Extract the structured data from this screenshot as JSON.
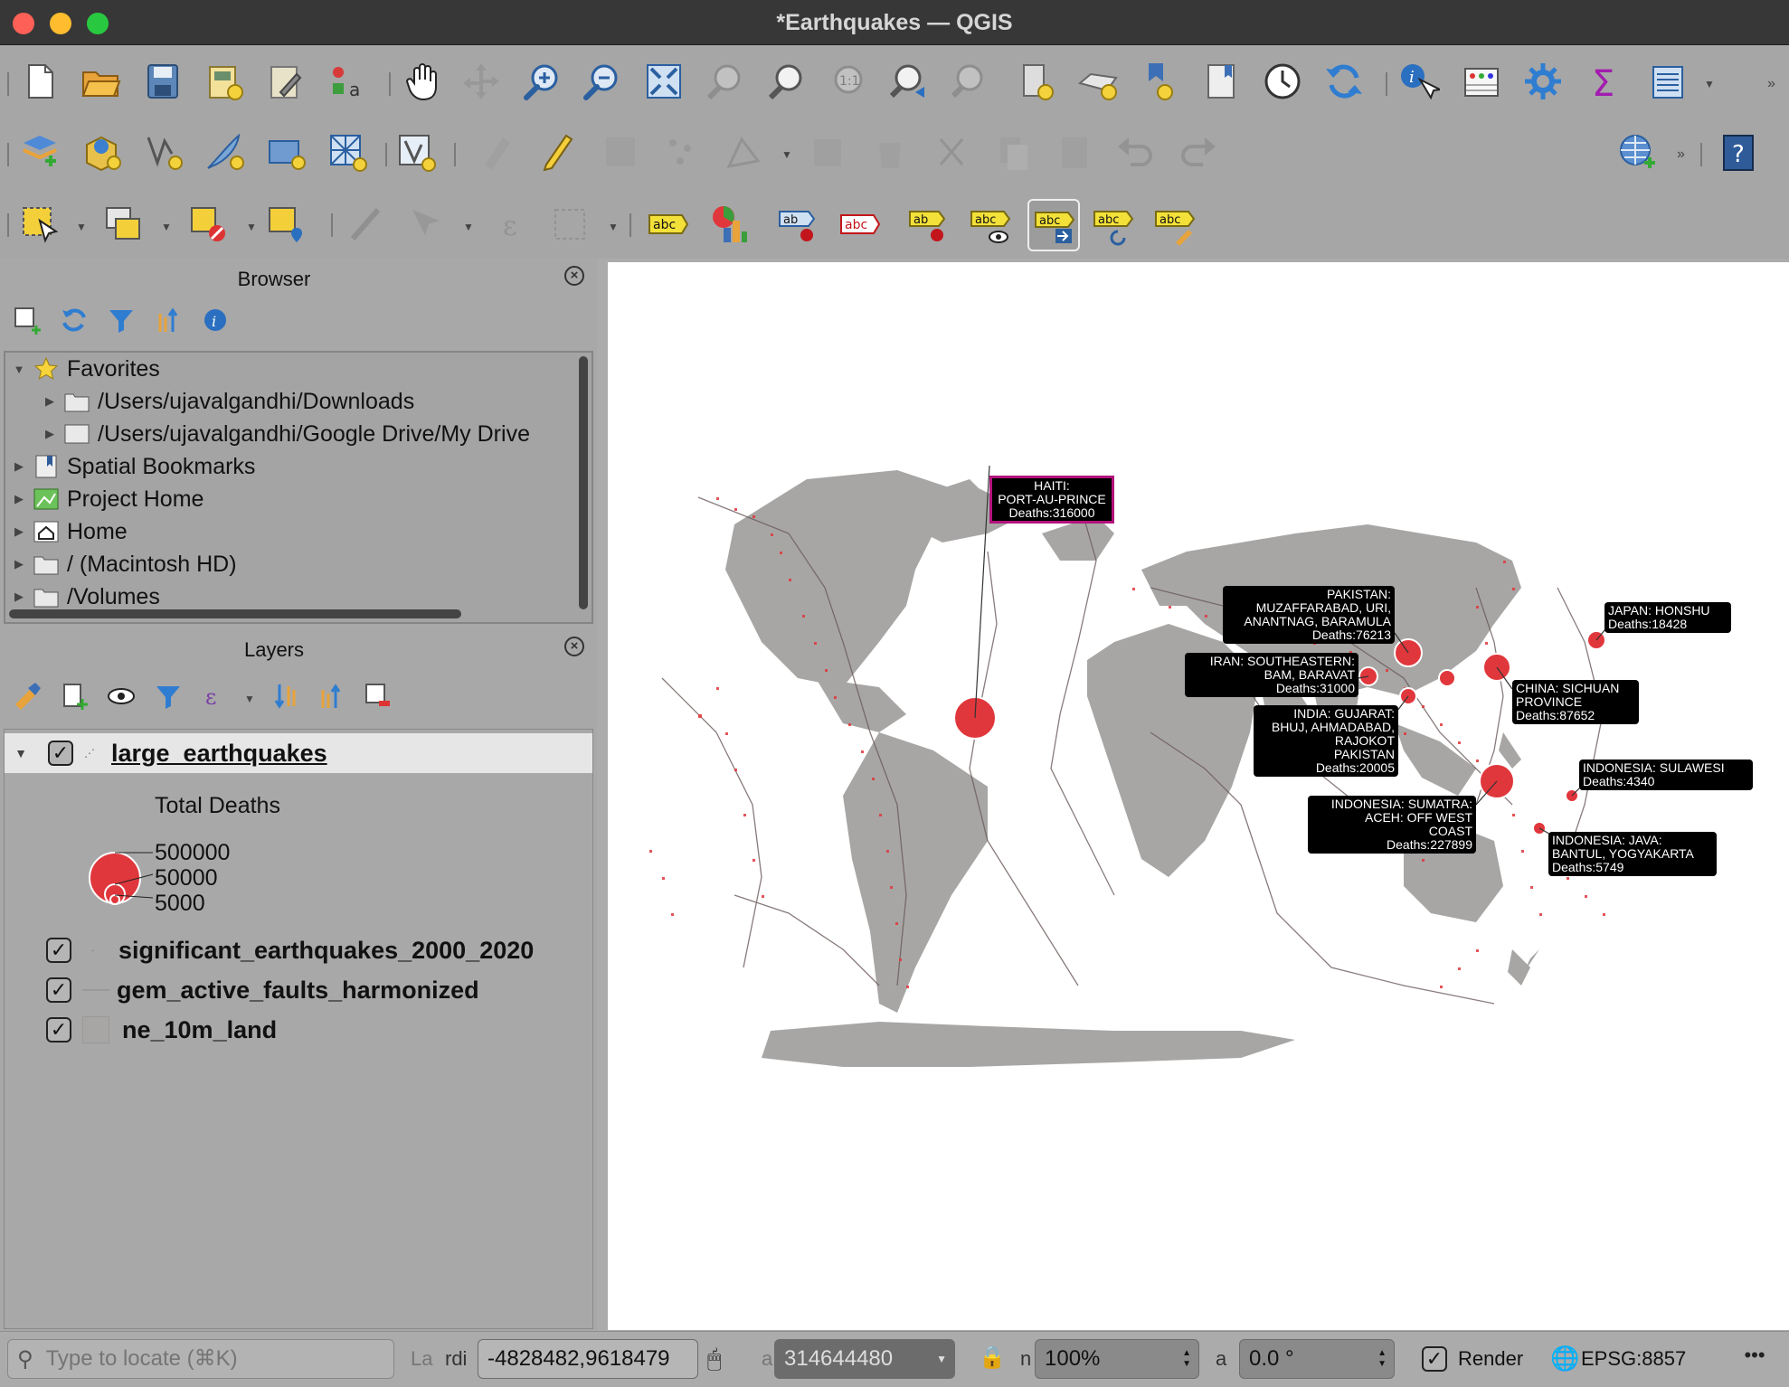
{
  "window": {
    "title": "*Earthquakes — QGIS"
  },
  "browser": {
    "title": "Browser",
    "items": [
      {
        "label": "Favorites"
      },
      {
        "label": "/Users/ujavalgandhi/Downloads"
      },
      {
        "label": "/Users/ujavalgandhi/Google Drive/My Drive"
      },
      {
        "label": "Spatial Bookmarks"
      },
      {
        "label": "Project Home"
      },
      {
        "label": "Home"
      },
      {
        "label": "/ (Macintosh HD)"
      },
      {
        "label": "/Volumes"
      }
    ]
  },
  "layers": {
    "title": "Layers",
    "active_layer": "large_earthquakes",
    "legend_title": "Total Deaths",
    "legend_values": [
      "500000",
      "50000",
      "5000"
    ],
    "others": [
      "significant_earthquakes_2000_2020",
      "gem_active_faults_harmonized",
      "ne_10m_land"
    ]
  },
  "map_labels": {
    "haiti": [
      "HAITI:",
      "PORT-AU-PRINCE",
      "Deaths:316000"
    ],
    "pakistan": [
      "PAKISTAN:",
      "MUZAFFARABAD, URI,",
      "ANANTNAG, BARAMULA",
      "Deaths:76213"
    ],
    "iran": [
      "IRAN:  SOUTHEASTERN:",
      "BAM, BARAVAT",
      "Deaths:31000"
    ],
    "india": [
      "INDIA:  GUJARAT:",
      "BHUJ, AHMADABAD,",
      "RAJOKOT",
      "PAKISTAN",
      "Deaths:20005"
    ],
    "japan": [
      "JAPAN:  HONSHU",
      "Deaths:18428"
    ],
    "china": [
      "CHINA:  SICHUAN",
      "PROVINCE",
      "Deaths:87652"
    ],
    "sulawesi": [
      "INDONESIA:  SULAWESI",
      "Deaths:4340"
    ],
    "sumatra": [
      "INDONESIA:  SUMATRA:",
      "ACEH:  OFF WEST",
      "COAST",
      "Deaths:227899"
    ],
    "java": [
      "INDONESIA:  JAVA:",
      "BANTUL, YOGYAKARTA",
      "Deaths:5749"
    ]
  },
  "statusbar": {
    "locate_placeholder": "Type to locate (⌘K)",
    "coord_label": "rdi",
    "coordinate": "-4828482,9618479",
    "scale": "314644480",
    "magnifier": "100%",
    "rotation": "0.0 °",
    "render_label": "Render",
    "crs": "EPSG:8857"
  },
  "colors": {
    "quake": "#e0373c",
    "land": "#a7a6a5",
    "label_bg": "#000000",
    "highlight": "#b3127c"
  }
}
